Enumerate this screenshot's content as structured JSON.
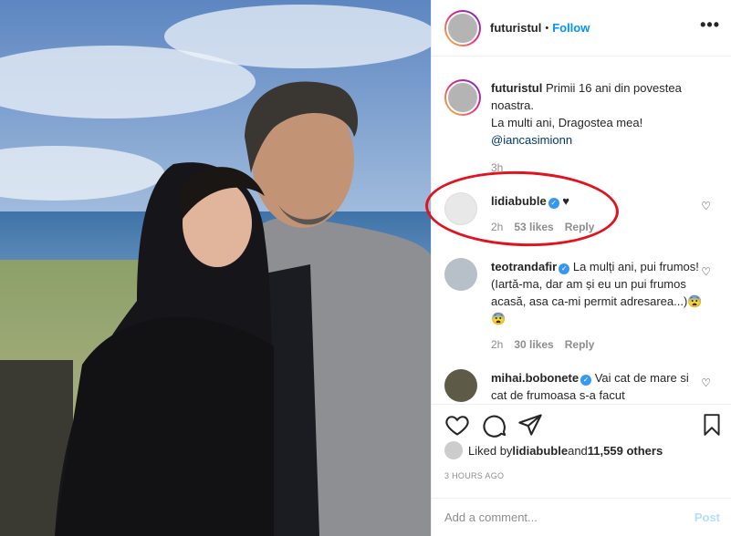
{
  "header": {
    "username": "futuristul",
    "separator": "•",
    "follow_label": "Follow",
    "more_label": "•••"
  },
  "caption": {
    "username": "futuristul",
    "text_line1": " Primii 16 ani din povestea noastra.",
    "text_line2": "La multi ani, Dragostea mea!",
    "mention": "@iancasimionn",
    "time": "3h"
  },
  "comments": [
    {
      "username": "lidiabuble",
      "text": "♥",
      "time": "2h",
      "likes": "53 likes",
      "reply": "Reply"
    },
    {
      "username": "teotrandafir",
      "text": "La mulți ani, pui frumos! (Iartă-ma, dar am și eu un pui frumos acasă, asa ca-mi permit adresarea...)😨😨",
      "time": "2h",
      "likes": "30 likes",
      "reply": "Reply"
    },
    {
      "username": "mihai.bobonete",
      "text": "Vai cat de mare si cat de frumoasa s-a facut"
    }
  ],
  "likes": {
    "prefix": "Liked by ",
    "user": "lidiabuble",
    "middle": " and ",
    "count": "11,559 others"
  },
  "timestamp": "3 HOURS AGO",
  "add_comment": {
    "placeholder": "Add a comment...",
    "post_label": "Post"
  },
  "colors": {
    "accent": "#0095f6",
    "verified": "#3897f0",
    "annotation": "#e0131f"
  }
}
